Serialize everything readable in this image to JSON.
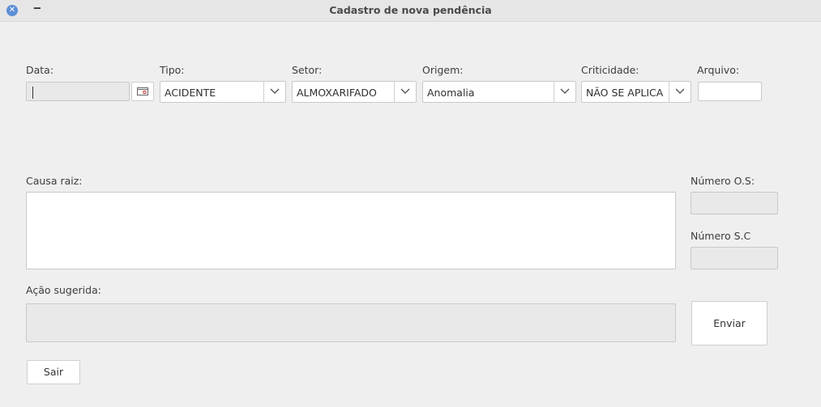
{
  "window": {
    "title": "Cadastro de nova pendência"
  },
  "form": {
    "data_label": "Data:",
    "data_value": "",
    "tipo_label": "Tipo:",
    "tipo_value": "ACIDENTE",
    "setor_label": "Setor:",
    "setor_value": "ALMOXARIFADO",
    "origem_label": "Origem:",
    "origem_value": "Anomalia",
    "criticidade_label": "Criticidade:",
    "criticidade_value": "NÃO SE APLICA",
    "arquivo_label": "Arquivo:",
    "causa_label": "Causa raiz:",
    "acao_label": "Ação sugerida:",
    "os_label": "Número O.S:",
    "sc_label": "Número S.C"
  },
  "buttons": {
    "enviar": "Enviar",
    "sair": "Sair"
  },
  "icons": {
    "close": "close-icon",
    "minimize": "minimize-icon",
    "calendar": "calendar-icon",
    "dropdown": "chevron-down-icon"
  },
  "colors": {
    "close_button": "#5b8fd6",
    "background": "#efefef"
  }
}
